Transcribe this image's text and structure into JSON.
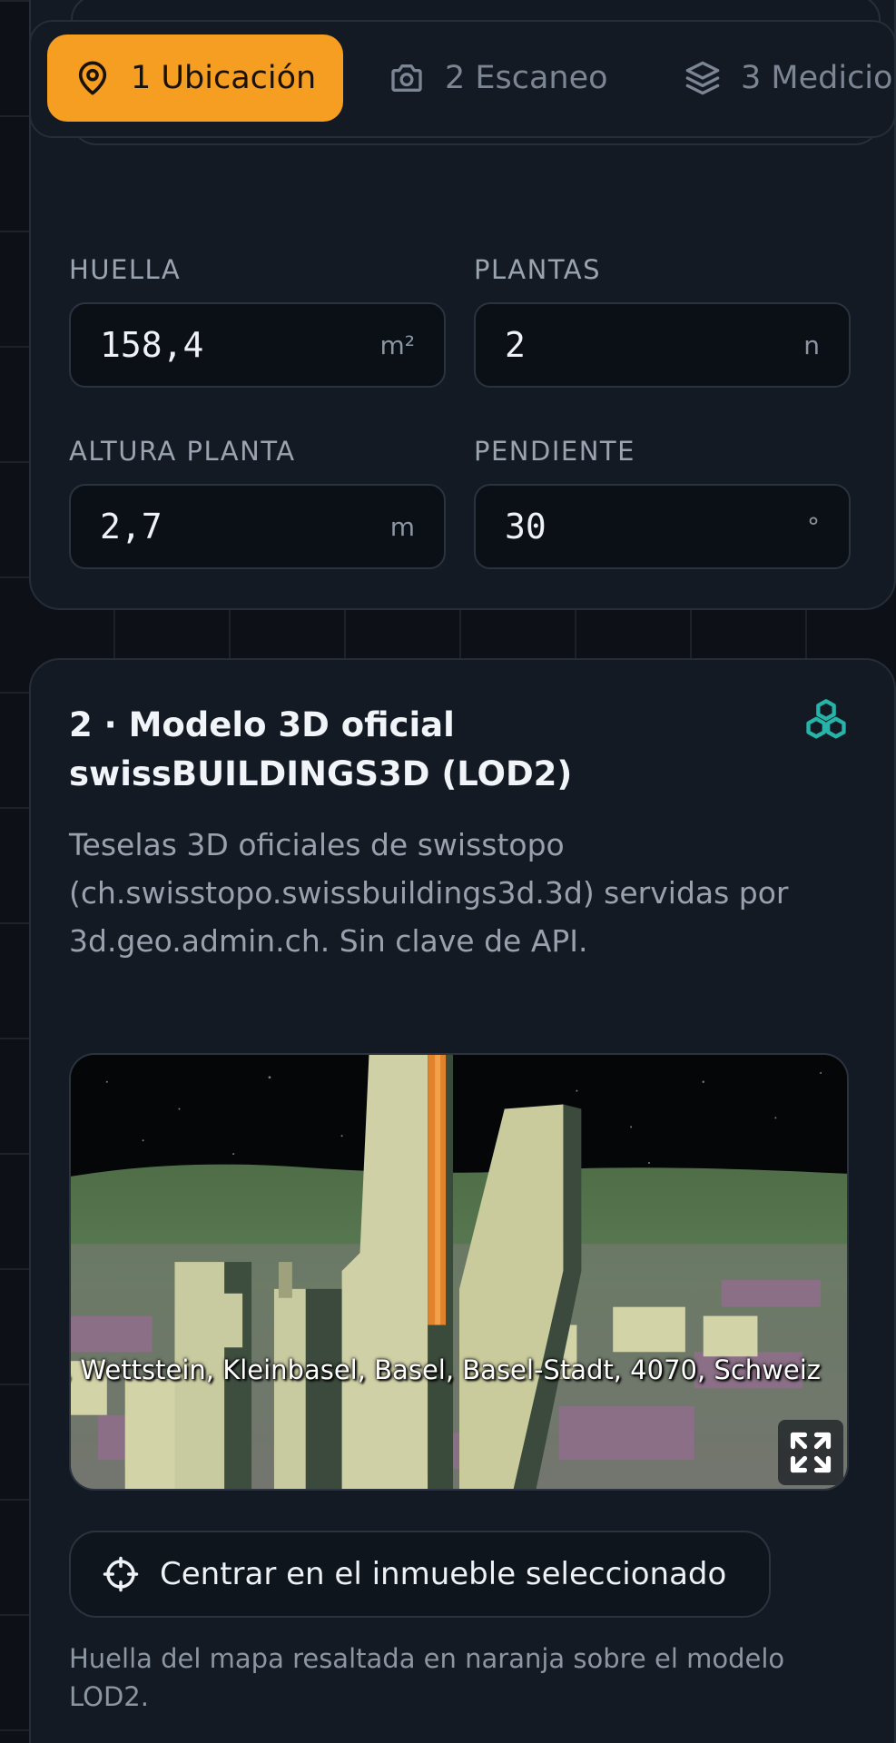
{
  "tabs": [
    {
      "label": "1 Ubicación",
      "icon": "map-pin-icon",
      "active": true
    },
    {
      "label": "2 Escaneo",
      "icon": "camera-icon",
      "active": false
    },
    {
      "label": "3 Medicio",
      "icon": "layers-icon",
      "active": false
    }
  ],
  "fields": {
    "huella": {
      "label": "HUELLA",
      "value": "158,4",
      "unit": "m²"
    },
    "plantas": {
      "label": "PLANTAS",
      "value": "2",
      "unit": "n"
    },
    "altura": {
      "label": "ALTURA PLANTA",
      "value": "2,7",
      "unit": "m"
    },
    "pendiente": {
      "label": "PENDIENTE",
      "value": "30",
      "unit": "°"
    }
  },
  "model_section": {
    "title": "2 · Modelo 3D oficial swissBUILDINGS3D (LOD2)",
    "icon": "cubes-icon",
    "description": "Teselas 3D oficiales de swisstopo (ch.swisstopo.swissbuildings3d.3d) servidas por 3d.geo.admin.ch. Sin clave de API.",
    "viewer_label": ", Wettstein, Kleinbasel, Basel, Basel-Stadt, 4070, Schweiz",
    "center_button": "Centrar en el inmueble seleccionado",
    "footnote": "Huella del mapa resaltada en naranja sobre el modelo LOD2."
  },
  "colors": {
    "accent": "#f59e22",
    "teal": "#26b3a8",
    "background": "#0d1117",
    "card": "#131a23"
  }
}
